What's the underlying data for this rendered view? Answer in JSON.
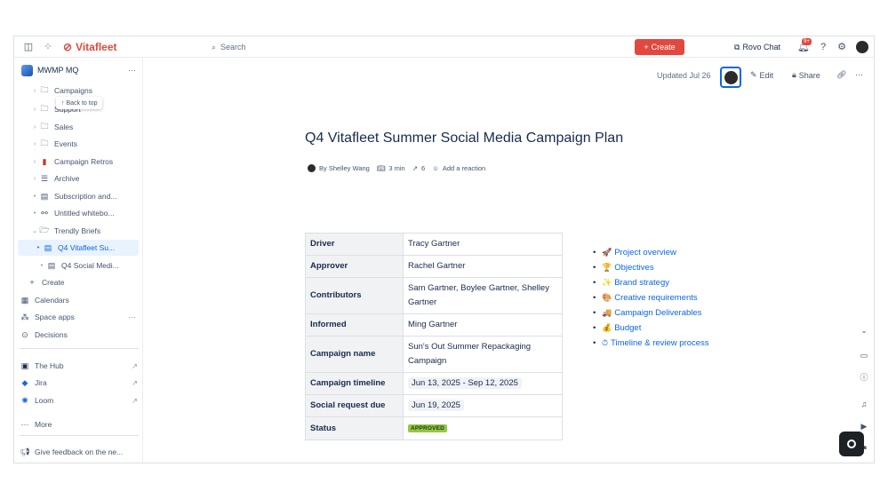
{
  "app": {
    "brand": "Vitafleet"
  },
  "topbar": {
    "search_placeholder": "Search",
    "create_label": "Create",
    "rovo_label": "Rovo Chat",
    "notification_badge": "9+",
    "icons": [
      "sidebar-toggle-icon",
      "app-switcher-icon",
      "bell-icon",
      "help-icon",
      "settings-icon"
    ]
  },
  "sidebar": {
    "space_name": "MWMP MQ",
    "back_to_top": "↑ Back to top",
    "items": [
      {
        "label": "Campaigns",
        "icon": "folder"
      },
      {
        "label": "Support",
        "icon": "folder"
      },
      {
        "label": "Sales",
        "icon": "folder"
      },
      {
        "label": "Events",
        "icon": "folder"
      },
      {
        "label": "Campaign Retros",
        "icon": "book"
      },
      {
        "label": "Archive",
        "icon": "archive"
      },
      {
        "label": "Subscription and...",
        "icon": "page"
      },
      {
        "label": "Untitled whitebo...",
        "icon": "whiteboard"
      },
      {
        "label": "Trendly Briefs",
        "icon": "folder-open"
      },
      {
        "label": "Q4 Vitafleet Su...",
        "icon": "page"
      },
      {
        "label": "Q4 Social Medi...",
        "icon": "page"
      }
    ],
    "create_label": "Create",
    "calendars_label": "Calendars",
    "space_apps_label": "Space apps",
    "decisions_label": "Decisions",
    "links": [
      {
        "label": "The Hub"
      },
      {
        "label": "Jira"
      },
      {
        "label": "Loom"
      }
    ],
    "more_label": "More",
    "feedback_label": "Give feedback on the ne..."
  },
  "page": {
    "updated": "Updated Jul 26",
    "edit_label": "Edit",
    "share_label": "Share",
    "title": "Q4 Vitafleet Summer Social Media Campaign Plan",
    "author": "By Shelley Wang",
    "read_time": "3 min",
    "views": "6",
    "reaction_label": "Add a reaction"
  },
  "table": {
    "rows": [
      {
        "key": "Driver",
        "value": "Tracy Gartner"
      },
      {
        "key": "Approver",
        "value": "Rachel Gartner"
      },
      {
        "key": "Contributors",
        "value": "Sam Gartner, Boylee Gartner, Shelley Gartner"
      },
      {
        "key": "Informed",
        "value": "Ming Gartner"
      },
      {
        "key": "Campaign name",
        "value": "Sun's Out Summer Repackaging Campaign"
      },
      {
        "key": "Campaign timeline",
        "value": "Jun 13, 2025 - Sep 12, 2025"
      },
      {
        "key": "Social request due",
        "value": "Jun 19, 2025"
      },
      {
        "key": "Status",
        "value": "APPROVED"
      }
    ]
  },
  "toc": [
    {
      "emoji": "🚀",
      "label": "Project overview"
    },
    {
      "emoji": "🏆",
      "label": "Objectives"
    },
    {
      "emoji": "✨",
      "label": "Brand strategy"
    },
    {
      "emoji": "🎨",
      "label": "Creative requirements"
    },
    {
      "emoji": "🚚",
      "label": "Campaign Deliverables"
    },
    {
      "emoji": "💰",
      "label": "Budget"
    },
    {
      "emoji": "⏱",
      "label": "Timeline & review process"
    }
  ],
  "colors": {
    "brand": "#e2483d",
    "link": "#0c66e4",
    "approved": "#94c748"
  }
}
